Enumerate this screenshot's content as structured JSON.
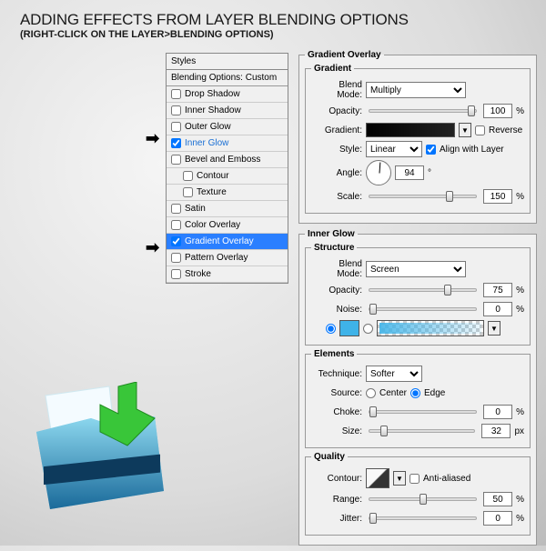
{
  "title": "ADDING EFFECTS FROM LAYER BLENDING OPTIONS",
  "subtitle": "(RIGHT-CLICK ON THE LAYER>BLENDING OPTIONS)",
  "styles": {
    "header": "Styles",
    "subheader": "Blending Options: Custom",
    "items": [
      {
        "label": "Drop Shadow",
        "checked": false,
        "active": false,
        "selected": false,
        "indent": false
      },
      {
        "label": "Inner Shadow",
        "checked": false,
        "active": false,
        "selected": false,
        "indent": false
      },
      {
        "label": "Outer Glow",
        "checked": false,
        "active": false,
        "selected": false,
        "indent": false
      },
      {
        "label": "Inner Glow",
        "checked": true,
        "active": true,
        "selected": false,
        "indent": false
      },
      {
        "label": "Bevel and Emboss",
        "checked": false,
        "active": false,
        "selected": false,
        "indent": false
      },
      {
        "label": "Contour",
        "checked": false,
        "active": false,
        "selected": false,
        "indent": true
      },
      {
        "label": "Texture",
        "checked": false,
        "active": false,
        "selected": false,
        "indent": true
      },
      {
        "label": "Satin",
        "checked": false,
        "active": false,
        "selected": false,
        "indent": false
      },
      {
        "label": "Color Overlay",
        "checked": false,
        "active": false,
        "selected": false,
        "indent": false
      },
      {
        "label": "Gradient Overlay",
        "checked": true,
        "active": false,
        "selected": true,
        "indent": false
      },
      {
        "label": "Pattern Overlay",
        "checked": false,
        "active": false,
        "selected": false,
        "indent": false
      },
      {
        "label": "Stroke",
        "checked": false,
        "active": false,
        "selected": false,
        "indent": false
      }
    ]
  },
  "gradient_overlay": {
    "legend": "Gradient Overlay",
    "gradient_legend": "Gradient",
    "blend_mode_label": "Blend Mode:",
    "blend_mode": "Multiply",
    "opacity_label": "Opacity:",
    "opacity": "100",
    "opacity_unit": "%",
    "gradient_label": "Gradient:",
    "reverse_label": "Reverse",
    "reverse": false,
    "style_label": "Style:",
    "style": "Linear",
    "align_label": "Align with Layer",
    "align": true,
    "angle_label": "Angle:",
    "angle": "94",
    "angle_unit": "°",
    "scale_label": "Scale:",
    "scale": "150",
    "scale_unit": "%"
  },
  "inner_glow": {
    "legend": "Inner Glow",
    "structure_legend": "Structure",
    "blend_mode_label": "Blend Mode:",
    "blend_mode": "Screen",
    "opacity_label": "Opacity:",
    "opacity": "75",
    "opacity_unit": "%",
    "noise_label": "Noise:",
    "noise": "0",
    "noise_unit": "%",
    "elements_legend": "Elements",
    "technique_label": "Technique:",
    "technique": "Softer",
    "source_label": "Source:",
    "source_center": "Center",
    "source_edge": "Edge",
    "choke_label": "Choke:",
    "choke": "0",
    "choke_unit": "%",
    "size_label": "Size:",
    "size": "32",
    "size_unit": "px",
    "quality_legend": "Quality",
    "contour_label": "Contour:",
    "antialiased_label": "Anti-aliased",
    "antialiased": false,
    "range_label": "Range:",
    "range": "50",
    "range_unit": "%",
    "jitter_label": "Jitter:",
    "jitter": "0",
    "jitter_unit": "%"
  }
}
